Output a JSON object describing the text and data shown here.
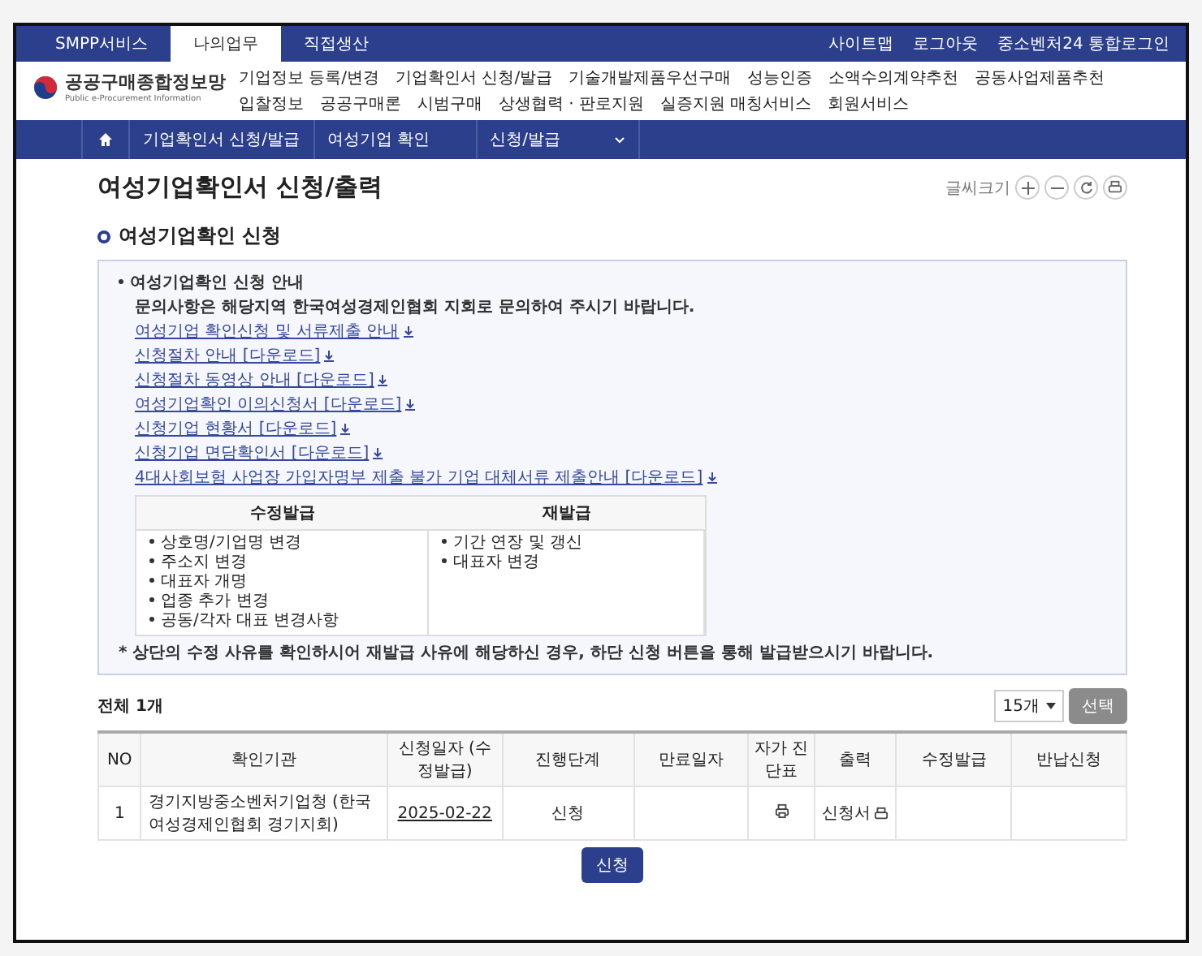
{
  "top_bar": {
    "tabs": [
      {
        "label": "SMPP서비스",
        "selected": false
      },
      {
        "label": "나의업무",
        "selected": true
      },
      {
        "label": "직접생산",
        "selected": false
      }
    ],
    "links": [
      "사이트맵",
      "로그아웃",
      "중소벤처24 통합로그인"
    ]
  },
  "header": {
    "logo": {
      "title": "공공구매종합정보망",
      "subtitle": "Public e-Procurement Information"
    },
    "nav": [
      "기업정보 등록/변경",
      "기업확인서 신청/발급",
      "기술개발제품우선구매",
      "성능인증",
      "소액수의계약추천",
      "공동사업제품추천",
      "입찰정보",
      "공공구매론",
      "시범구매",
      "상생협력 · 판로지원",
      "실증지원 매칭서비스",
      "회원서비스"
    ]
  },
  "breadcrumb": [
    {
      "label": "기업확인서 신청/발급",
      "dropdown": false
    },
    {
      "label": "여성기업 확인",
      "dropdown": false
    },
    {
      "label": "신청/발급",
      "dropdown": true
    }
  ],
  "page": {
    "title": "여성기업확인서 신청/출력",
    "font_size_label": "글씨크기"
  },
  "section_title": "여성기업확인 신청",
  "guide": {
    "heading": "여성기업확인 신청 안내",
    "notice": "문의사항은 해당지역 한국여성경제인협회 지회로 문의하여 주시기 바랍니다.",
    "links": [
      "여성기업 확인신청 및 서류제출 안내",
      "신청절차 안내 [다운로드]",
      "신청절차 동영상 안내 [다운로드]",
      "여성기업확인 이의신청서 [다운로드]",
      "신청기업 현황서 [다운로드]",
      "신청기업 면담확인서 [다운로드]",
      "4대사회보험 사업장 가입자명부 제출 불가 기업 대체서류 제출안내 [다운로드]"
    ],
    "table": {
      "columns": [
        {
          "title": "수정발급",
          "items": [
            "상호명/기업명 변경",
            "주소지 변경",
            "대표자 개명",
            "업종 추가 변경",
            "공동/각자 대표 변경사항"
          ]
        },
        {
          "title": "재발급",
          "items": [
            "기간 연장 및 갱신",
            "대표자 변경"
          ]
        }
      ]
    },
    "note": "* 상단의 수정 사유를 확인하시어 재발급 사유에 해당하신 경우, 하단 신청 버튼을 통해 발급받으시기 바랍니다."
  },
  "list": {
    "total": "전체 1개",
    "page_size": "15개",
    "select_button": {
      "label": "선택",
      "disabled": true
    },
    "columns": [
      "NO",
      "확인기관",
      "신청일자 (수정발급)",
      "진행단계",
      "만료일자",
      "자가 진단표",
      "출력",
      "수정발급",
      "반납신청"
    ],
    "rows": [
      {
        "no": "1",
        "agency": "경기지방중소벤처기업청 (한국여성경제인협회 경기지회)",
        "date": "2025-02-22",
        "stage": "신청",
        "print_label": "신청서"
      }
    ],
    "apply_button": "신청"
  }
}
